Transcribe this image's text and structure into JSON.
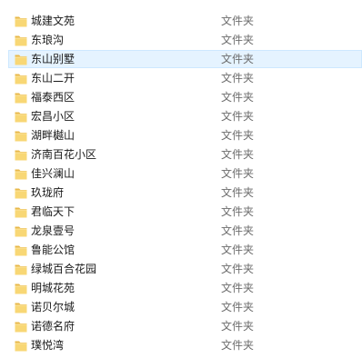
{
  "files": [
    {
      "name": "城建文苑",
      "type": "文件夹",
      "icon": "folder-icon"
    },
    {
      "name": "东琅沟",
      "type": "文件夹",
      "icon": "folder-icon"
    },
    {
      "name": "东山别墅",
      "type": "文件夹",
      "icon": "folder-icon",
      "selected": true
    },
    {
      "name": "东山二开",
      "type": "文件夹",
      "icon": "folder-icon"
    },
    {
      "name": "福泰西区",
      "type": "文件夹",
      "icon": "folder-icon"
    },
    {
      "name": "宏昌小区",
      "type": "文件夹",
      "icon": "folder-icon"
    },
    {
      "name": "湖畔樾山",
      "type": "文件夹",
      "icon": "folder-icon"
    },
    {
      "name": "济南百花小区",
      "type": "文件夹",
      "icon": "folder-icon"
    },
    {
      "name": "佳兴澜山",
      "type": "文件夹",
      "icon": "folder-icon"
    },
    {
      "name": "玖珑府",
      "type": "文件夹",
      "icon": "folder-icon"
    },
    {
      "name": "君临天下",
      "type": "文件夹",
      "icon": "folder-icon"
    },
    {
      "name": "龙泉壹号",
      "type": "文件夹",
      "icon": "folder-icon"
    },
    {
      "name": "鲁能公馆",
      "type": "文件夹",
      "icon": "folder-icon"
    },
    {
      "name": "绿城百合花园",
      "type": "文件夹",
      "icon": "folder-icon"
    },
    {
      "name": "明城花苑",
      "type": "文件夹",
      "icon": "folder-icon"
    },
    {
      "name": "诺贝尔城",
      "type": "文件夹",
      "icon": "folder-icon"
    },
    {
      "name": "诺德名府",
      "type": "文件夹",
      "icon": "folder-icon"
    },
    {
      "name": "璞悦湾",
      "type": "文件夹",
      "icon": "folder-icon"
    }
  ],
  "colors": {
    "selected_background": "#e5f3ff",
    "selected_border": "#cde8ff",
    "folder_fill": "#f8d775",
    "folder_shade": "#e8b84a",
    "type_text": "#6d6d6d"
  }
}
